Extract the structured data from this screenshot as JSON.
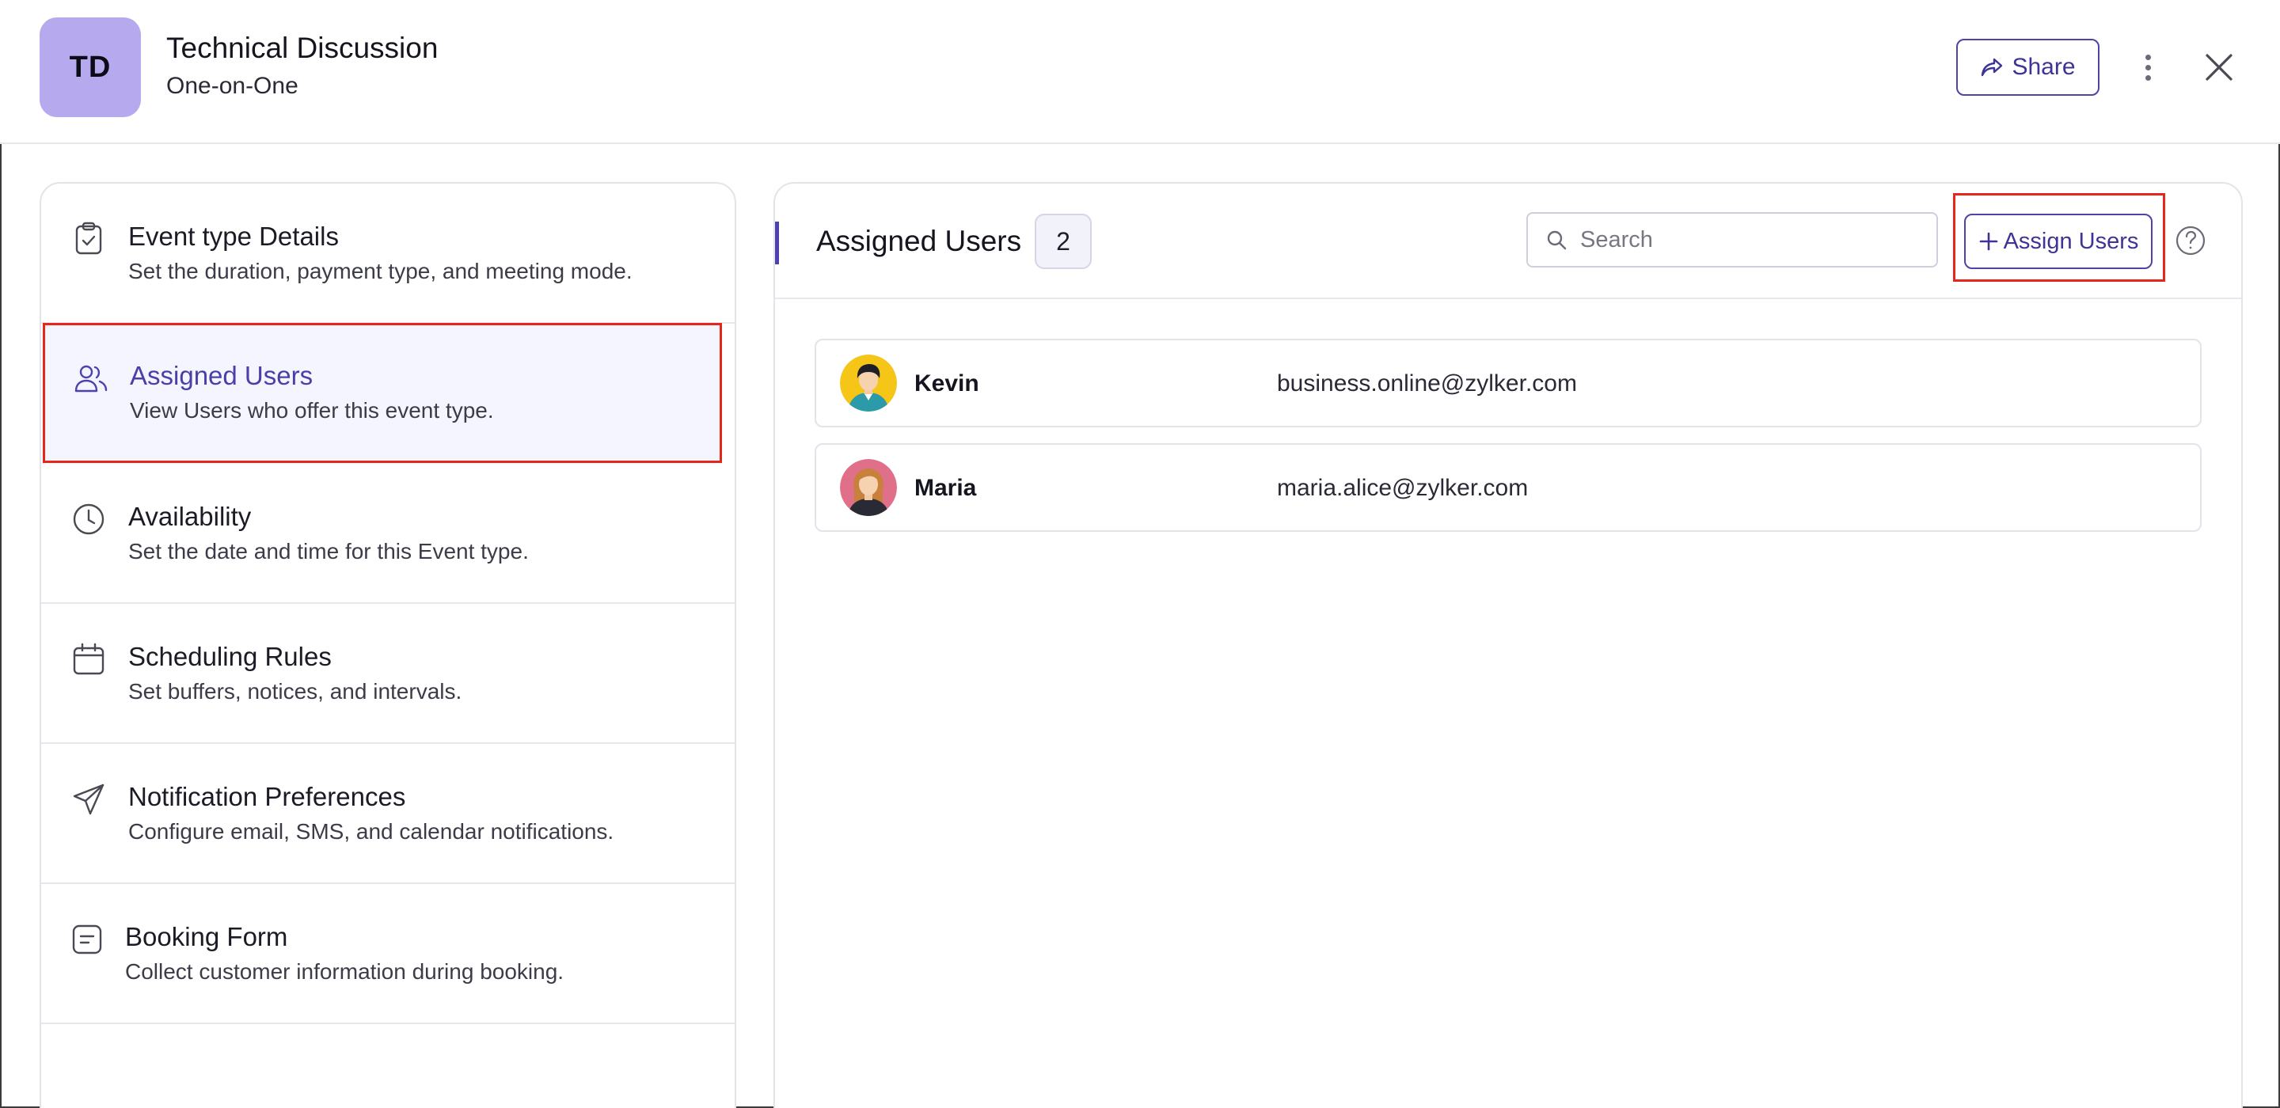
{
  "header": {
    "avatar_initials": "TD",
    "title": "Technical Discussion",
    "subtitle": "One-on-One",
    "share_label": "Share"
  },
  "sidebar": {
    "items": [
      {
        "icon": "clipboard-check-icon",
        "title": "Event type Details",
        "desc": "Set the duration, payment type, and meeting mode.",
        "active": false
      },
      {
        "icon": "users-icon",
        "title": "Assigned Users",
        "desc": "View Users who offer this event type.",
        "active": true
      },
      {
        "icon": "clock-icon",
        "title": "Availability",
        "desc": "Set the date and time for this Event type.",
        "active": false
      },
      {
        "icon": "calendar-icon",
        "title": "Scheduling Rules",
        "desc": "Set buffers, notices, and intervals.",
        "active": false
      },
      {
        "icon": "paper-plane-icon",
        "title": "Notification Preferences",
        "desc": "Configure email, SMS, and calendar notifications.",
        "active": false
      },
      {
        "icon": "form-icon",
        "title": "Booking Form",
        "desc": "Collect customer information during booking.",
        "active": false
      }
    ]
  },
  "main": {
    "title": "Assigned Users",
    "count": "2",
    "search_placeholder": "Search",
    "assign_label": "Assign Users",
    "users": [
      {
        "name": "Kevin",
        "email": "business.online@zylker.com",
        "avatar_bg": "#f5c518"
      },
      {
        "name": "Maria",
        "email": "maria.alice@zylker.com",
        "avatar_bg": "#e0708a"
      }
    ]
  },
  "colors": {
    "accent": "#4c41b0",
    "highlight": "#e5271b",
    "avatar_td": "#b7a9ee"
  }
}
